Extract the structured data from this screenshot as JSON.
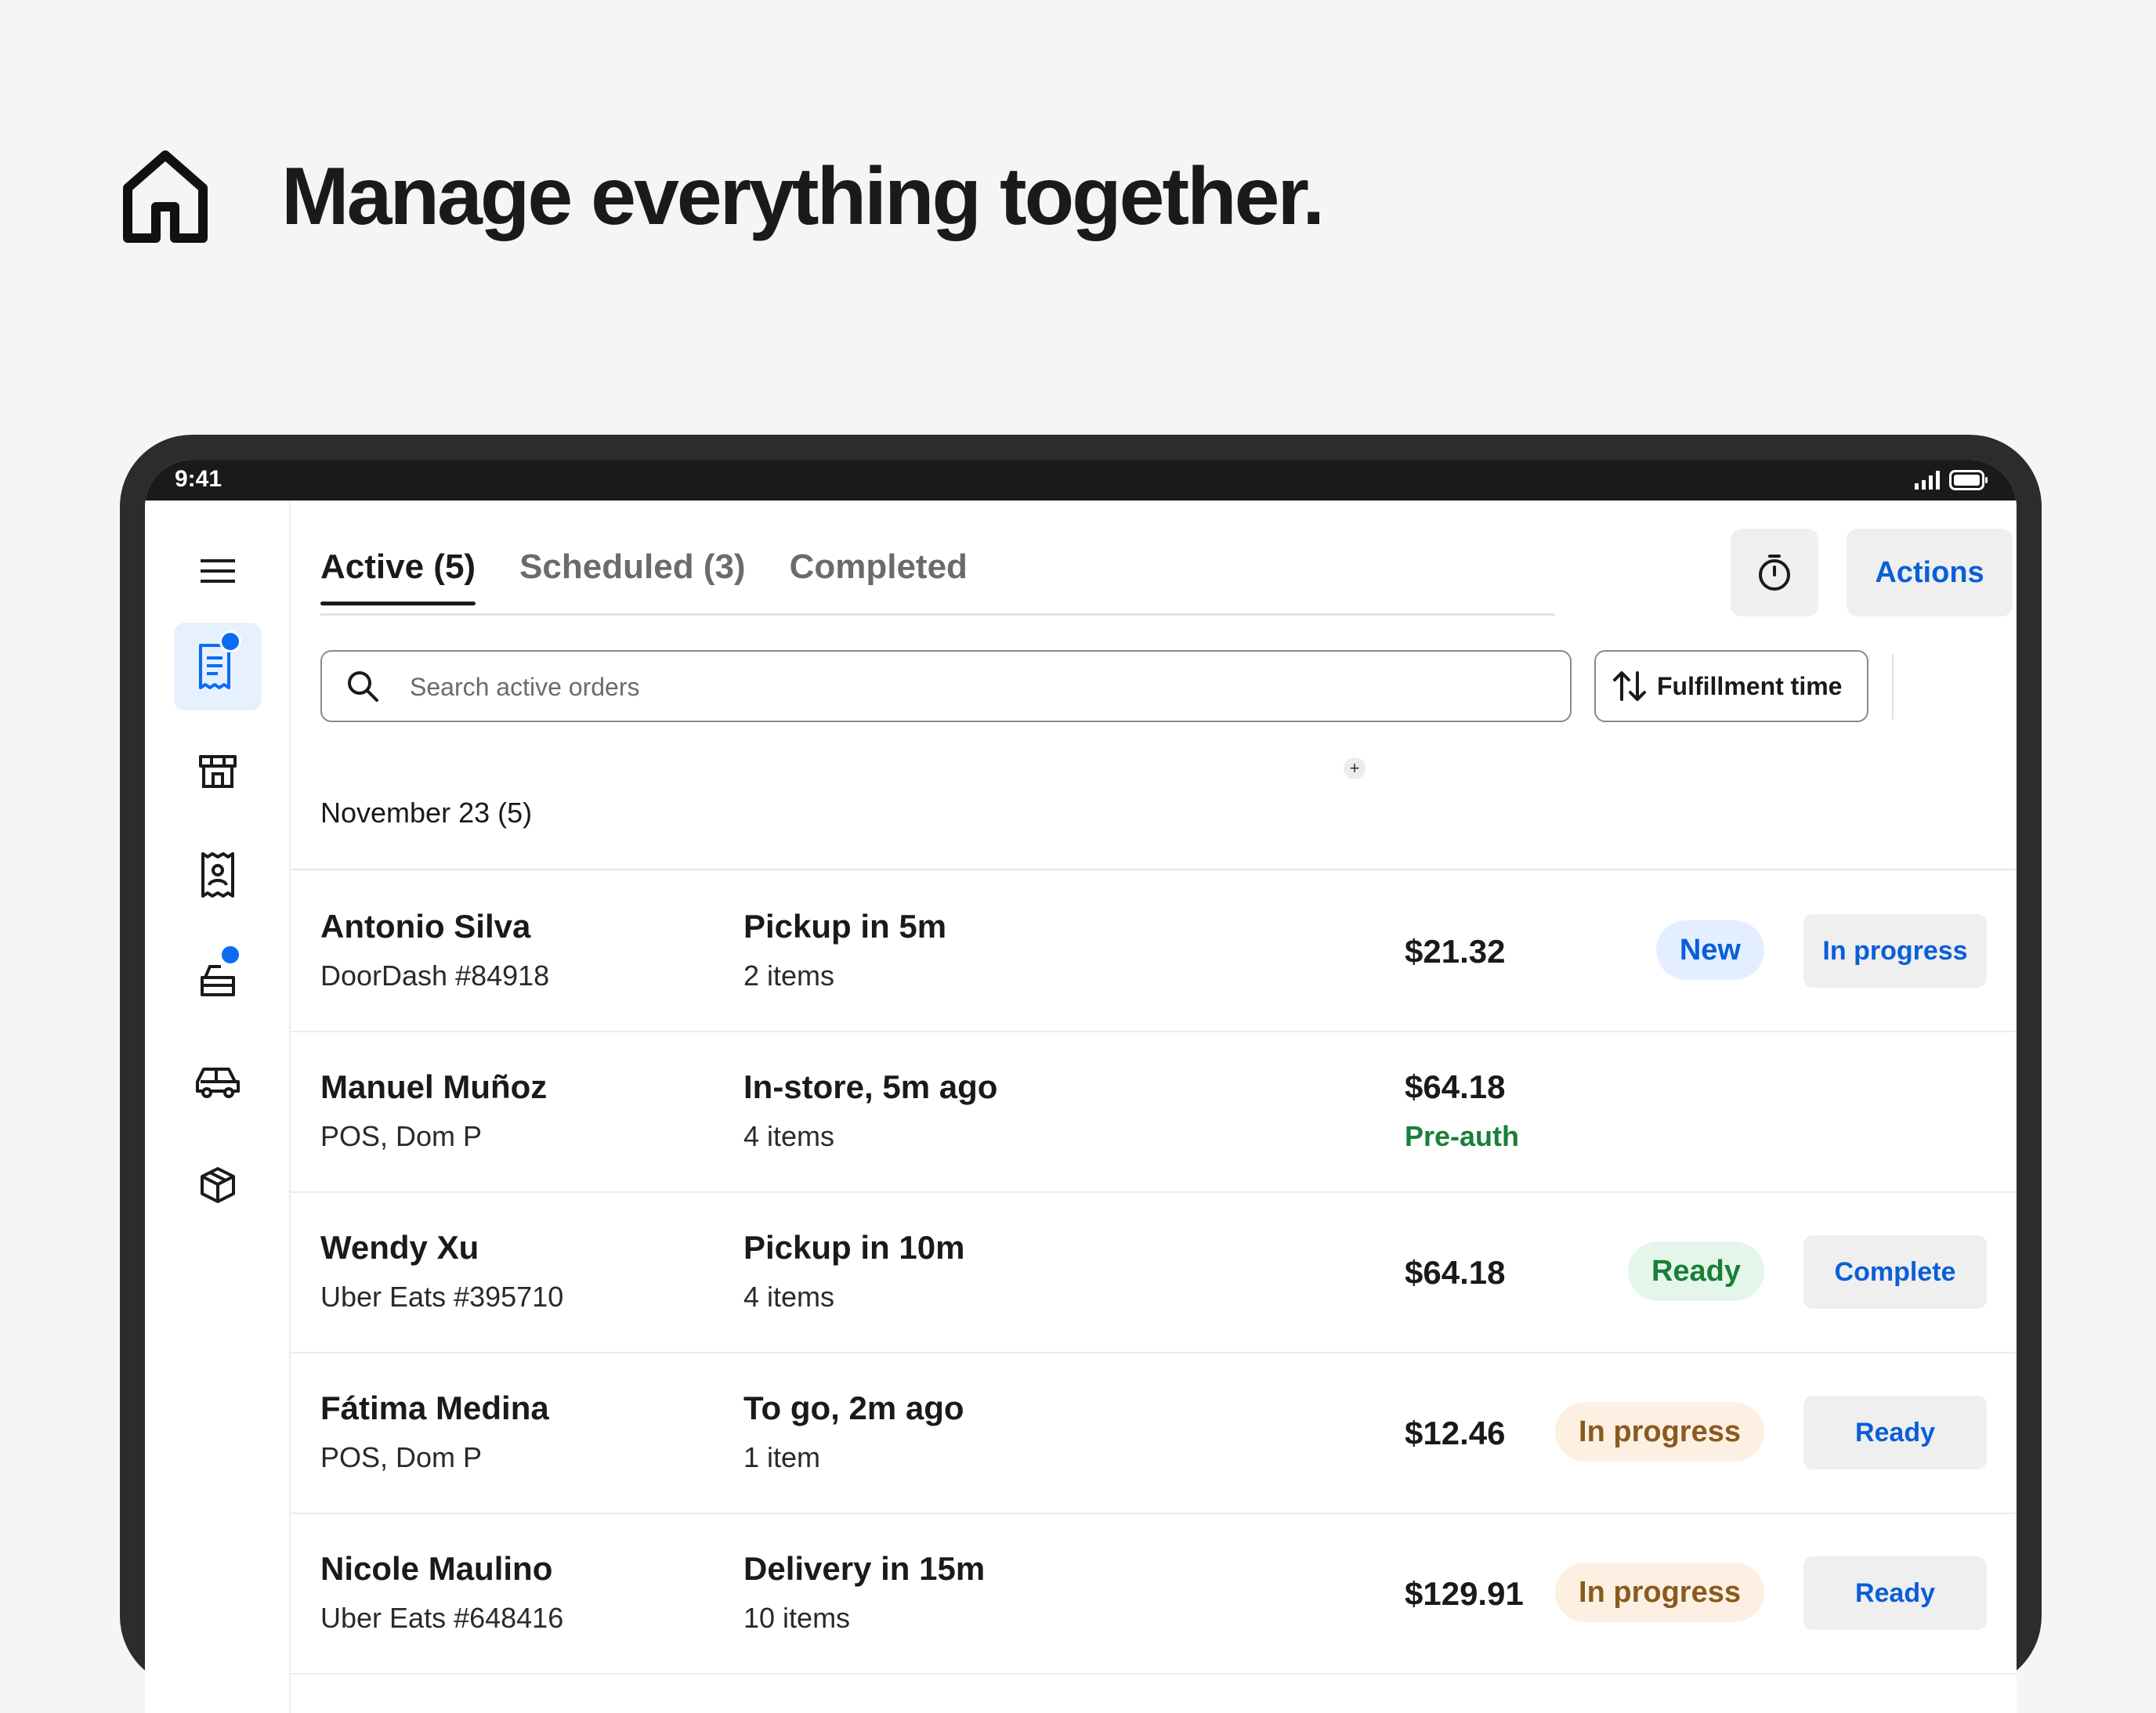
{
  "hero": {
    "title": "Manage everything together.",
    "icon": "home-icon"
  },
  "status_bar": {
    "time": "9:41"
  },
  "sidebar": {
    "items": [
      {
        "name": "menu",
        "icon": "hamburger-icon"
      },
      {
        "name": "orders",
        "icon": "receipt-icon",
        "active": true,
        "notification": true
      },
      {
        "name": "store",
        "icon": "storefront-icon"
      },
      {
        "name": "customers",
        "icon": "customer-receipt-icon"
      },
      {
        "name": "delivery",
        "icon": "delivery-icon",
        "notification": true
      },
      {
        "name": "vehicles",
        "icon": "car-icon"
      },
      {
        "name": "items",
        "icon": "box-icon"
      }
    ]
  },
  "tabs": [
    {
      "label": "Active (5)",
      "active": true
    },
    {
      "label": "Scheduled (3)"
    },
    {
      "label": "Completed"
    }
  ],
  "toolbar": {
    "timer_icon": "stopwatch-icon",
    "actions_label": "Actions",
    "add_icon": "plus-icon"
  },
  "search": {
    "placeholder": "Search active orders",
    "value": ""
  },
  "sort": {
    "label": "Fulfillment time",
    "icon": "sort-arrows-icon"
  },
  "filter": {
    "icon": "filter-icon"
  },
  "date_heading": "November 23 (5)",
  "orders": [
    {
      "name": "Antonio Silva",
      "source": "DoorDash #84918",
      "fulfillment": "Pickup in 5m",
      "items": "2 items",
      "price": "$21.32",
      "note": "",
      "status": "New",
      "action": "In progress"
    },
    {
      "name": "Manuel Muñoz",
      "source": "POS, Dom P",
      "fulfillment": "In-store, 5m ago",
      "items": "4 items",
      "price": "$64.18",
      "note": "Pre-auth",
      "status": "",
      "action": ""
    },
    {
      "name": "Wendy Xu",
      "source": "Uber Eats #395710",
      "fulfillment": "Pickup in 10m",
      "items": "4 items",
      "price": "$64.18",
      "note": "",
      "status": "Ready",
      "action": "Complete"
    },
    {
      "name": "Fátima Medina",
      "source": "POS, Dom P",
      "fulfillment": "To go, 2m ago",
      "items": "1 item",
      "price": "$12.46",
      "note": "",
      "status": "In progress",
      "action": "Ready"
    },
    {
      "name": "Nicole Maulino",
      "source": "Uber Eats #648416",
      "fulfillment": "Delivery in 15m",
      "items": "10 items",
      "price": "$129.91",
      "note": "",
      "status": "In progress",
      "action": "Ready"
    }
  ],
  "colors": {
    "accent": "#0a6cf5",
    "link": "#0a5fd8",
    "background": "#f6f5f3",
    "device_frame": "#2c2c2c",
    "status_ready": "#1a7f37",
    "status_progress": "#8a5a1e"
  }
}
